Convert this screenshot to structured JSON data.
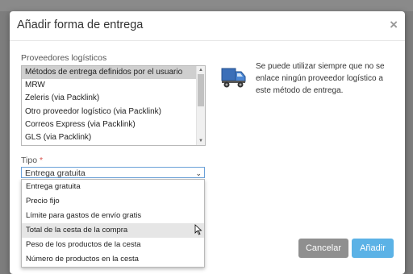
{
  "modal": {
    "title": "Añadir forma de entrega",
    "close_glyph": "×"
  },
  "providers": {
    "label": "Proveedores logísticos",
    "items": [
      "Métodos de entrega definidos por el usuario",
      "MRW",
      "Zeleris (via Packlink)",
      "Otro proveedor logístico (via Packlink)",
      "Correos Express (via Packlink)",
      "GLS (via Packlink)"
    ],
    "selected": "Métodos de entrega definidos por el usuario"
  },
  "info": {
    "icon": "truck-icon",
    "text": "Se puede utilizar siempre que no se enlace ningún proveedor logístico a este método de entrega."
  },
  "tipo": {
    "label": "Tipo",
    "required_mark": "*",
    "value": "Entrega gratuita",
    "options": [
      "Entrega gratuita",
      "Precio fijo",
      "Límite para gastos de envío gratis",
      "Total de la cesta de la compra",
      "Peso de los productos de la cesta",
      "Número de productos en la cesta"
    ],
    "hovered": "Total de la cesta de la compra"
  },
  "buttons": {
    "cancel": "Cancelar",
    "add": "Añadir"
  },
  "colors": {
    "cancel": "#8f8f8f",
    "add": "#5bb2e6",
    "required": "#d9534f"
  }
}
